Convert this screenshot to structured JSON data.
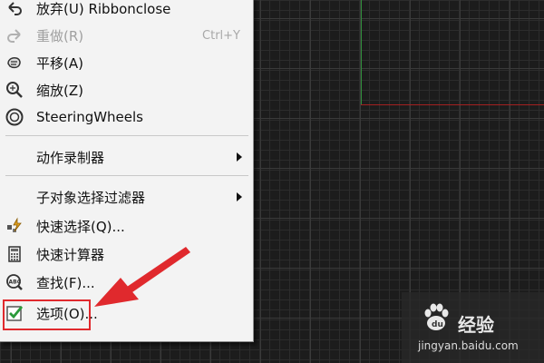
{
  "menu": {
    "items": [
      {
        "label": "放弃(U) Ribbonclose",
        "icon": "undo-icon",
        "enabled": true
      },
      {
        "label": "重做(R)",
        "icon": "redo-icon",
        "enabled": false,
        "shortcut": "Ctrl+Y"
      },
      {
        "label": "平移(A)",
        "icon": "pan-hand-icon",
        "enabled": true
      },
      {
        "label": "缩放(Z)",
        "icon": "zoom-magnifier-icon",
        "enabled": true
      },
      {
        "label": "SteeringWheels",
        "icon": "steering-wheel-icon",
        "enabled": true
      },
      {
        "label": "动作录制器",
        "enabled": true,
        "submenu": true
      },
      {
        "label": "子对象选择过滤器",
        "enabled": true,
        "submenu": true
      },
      {
        "label": "快速选择(Q)...",
        "icon": "quick-select-icon",
        "enabled": true
      },
      {
        "label": "快速计算器",
        "icon": "calculator-icon",
        "enabled": true
      },
      {
        "label": "查找(F)...",
        "icon": "find-abc-icon",
        "enabled": true
      },
      {
        "label": "选项(O)...",
        "icon": "checkmark-options-icon",
        "enabled": true,
        "highlighted": true
      }
    ]
  },
  "colors": {
    "highlight": "#e0292d",
    "axis_y": "#2f8f3a",
    "axis_x": "#a32020"
  },
  "watermark": {
    "brand": "经验",
    "url": "jingyan.baidu.com"
  }
}
